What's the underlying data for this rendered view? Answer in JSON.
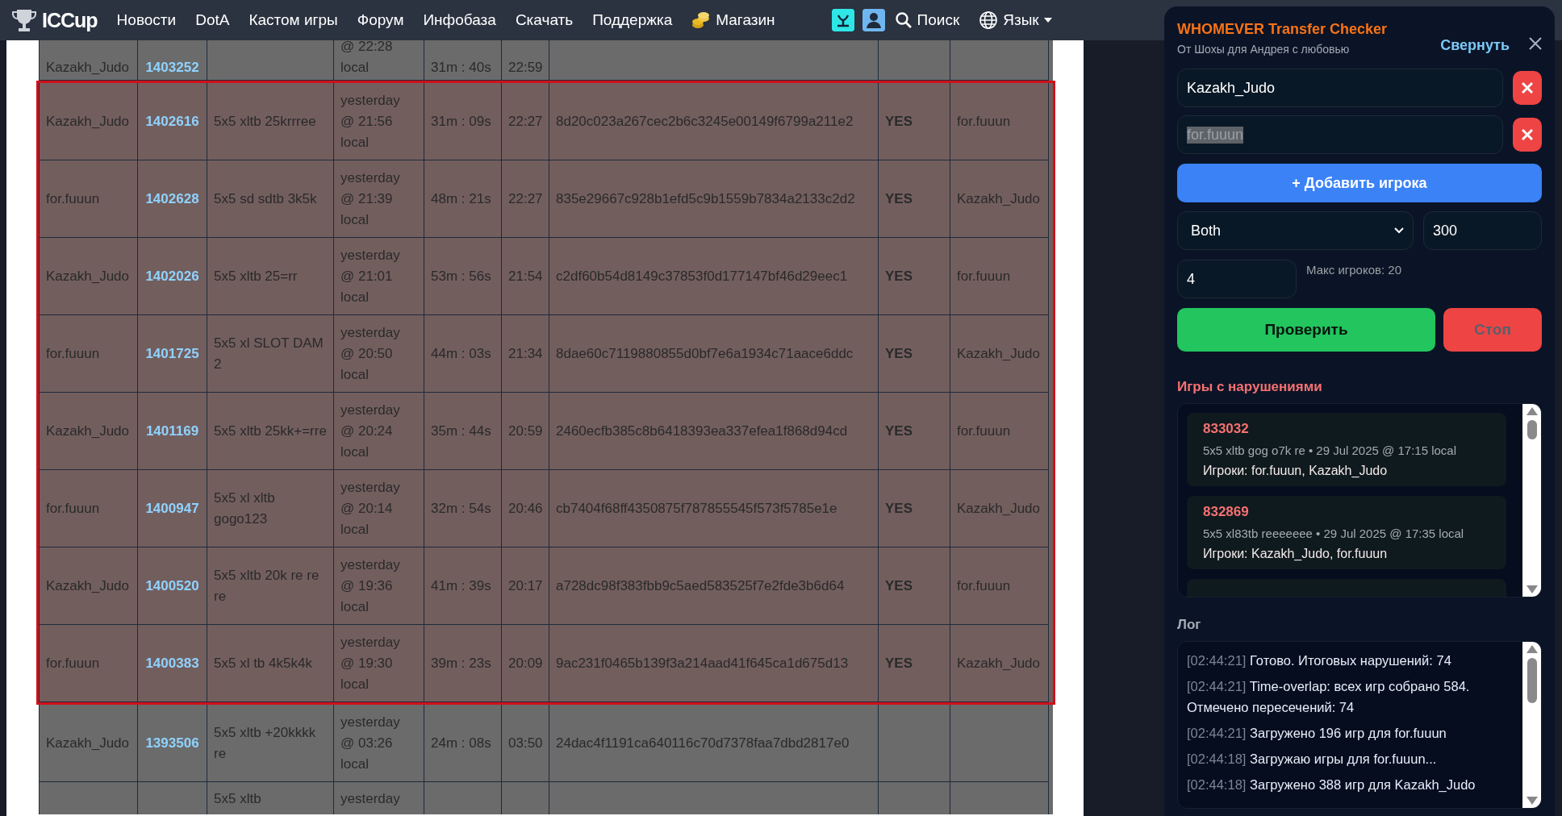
{
  "nav": {
    "logo": "ICCup",
    "items": [
      {
        "label": "Новости"
      },
      {
        "label": "DotA"
      },
      {
        "label": "Кастом игры"
      },
      {
        "label": "Форум"
      },
      {
        "label": "Инфобаза"
      },
      {
        "label": "Скачать"
      },
      {
        "label": "Поддержка"
      },
      {
        "label": "Магазин",
        "kind": "shop"
      }
    ],
    "search": "Поиск",
    "language": "Язык"
  },
  "table": {
    "rows": [
      {
        "player": "Kazakh_Judo",
        "game_id": "1403252",
        "game_name": "",
        "date": "@ 22:28 local",
        "duration": "31m : 40s",
        "end": "22:59",
        "hash": "",
        "transfer": "",
        "recipient": "",
        "flagged": false,
        "kind": "cut-top"
      },
      {
        "player": "Kazakh_Judo",
        "game_id": "1402616",
        "game_name": "5x5 xltb 25krrree",
        "date": "yesterday @ 21:56 local",
        "duration": "31m : 09s",
        "end": "22:27",
        "hash": "8d20c023a267cec2b6c3245e00149f6799a211e2",
        "transfer": "YES",
        "recipient": "for.fuuun",
        "flagged": true,
        "kind": "full"
      },
      {
        "player": "for.fuuun",
        "game_id": "1402628",
        "game_name": "5x5 sd sdtb 3k5k",
        "date": "yesterday @ 21:39 local",
        "duration": "48m : 21s",
        "end": "22:27",
        "hash": "835e29667c928b1efd5c9b1559b7834a2133c2d2",
        "transfer": "YES",
        "recipient": "Kazakh_Judo",
        "flagged": true,
        "kind": "full"
      },
      {
        "player": "Kazakh_Judo",
        "game_id": "1402026",
        "game_name": "5x5 xltb 25=rr",
        "date": "yesterday @ 21:01 local",
        "duration": "53m : 56s",
        "end": "21:54",
        "hash": "c2df60b54d8149c37853f0d177147bf46d29eec1",
        "transfer": "YES",
        "recipient": "for.fuuun",
        "flagged": true,
        "kind": "full"
      },
      {
        "player": "for.fuuun",
        "game_id": "1401725",
        "game_name": "5x5 xl SLOT DAM 2",
        "date": "yesterday @ 20:50 local",
        "duration": "44m : 03s",
        "end": "21:34",
        "hash": "8dae60c7119880855d0bf7e6a1934c71aace6ddc",
        "transfer": "YES",
        "recipient": "Kazakh_Judo",
        "flagged": true,
        "kind": "full"
      },
      {
        "player": "Kazakh_Judo",
        "game_id": "1401169",
        "game_name": "5x5 xltb 25kk+=rre",
        "date": "yesterday @ 20:24 local",
        "duration": "35m : 44s",
        "end": "20:59",
        "hash": "2460ecfb385c8b6418393ea337efea1f868d94cd",
        "transfer": "YES",
        "recipient": "for.fuuun",
        "flagged": true,
        "kind": "full"
      },
      {
        "player": "for.fuuun",
        "game_id": "1400947",
        "game_name": "5x5 xl xltb gogo123",
        "date": "yesterday @ 20:14 local",
        "duration": "32m : 54s",
        "end": "20:46",
        "hash": "cb7404f68ff4350875f787855545f573f5785e1e",
        "transfer": "YES",
        "recipient": "Kazakh_Judo",
        "flagged": true,
        "kind": "full"
      },
      {
        "player": "Kazakh_Judo",
        "game_id": "1400520",
        "game_name": "5x5 xltb 20k re re re",
        "date": "yesterday @ 19:36 local",
        "duration": "41m : 39s",
        "end": "20:17",
        "hash": "a728dc98f383fbb9c5aed583525f7e2fde3b6d64",
        "transfer": "YES",
        "recipient": "for.fuuun",
        "flagged": true,
        "kind": "full"
      },
      {
        "player": "for.fuuun",
        "game_id": "1400383",
        "game_name": "5x5 xl tb 4k5k4k",
        "date": "yesterday @ 19:30 local",
        "duration": "39m : 23s",
        "end": "20:09",
        "hash": "9ac231f0465b139f3a214aad41f645ca1d675d13",
        "transfer": "YES",
        "recipient": "Kazakh_Judo",
        "flagged": true,
        "kind": "full"
      },
      {
        "player": "Kazakh_Judo",
        "game_id": "1393506",
        "game_name": "5x5 xltb +20kkkk re",
        "date": "yesterday @ 03:26 local",
        "duration": "24m : 08s",
        "end": "03:50",
        "hash": "24dac4f1191ca640116c70d7378faa7dbd2817e0",
        "transfer": "",
        "recipient": "",
        "flagged": false,
        "kind": "full"
      },
      {
        "player": "",
        "game_id": "",
        "game_name": "5x5 xltb",
        "date": "yesterday",
        "duration": "",
        "end": "",
        "hash": "",
        "transfer": "",
        "recipient": "",
        "flagged": false,
        "kind": "cut-bottom"
      }
    ]
  },
  "panel": {
    "title": "WHOMEVER Transfer Checker",
    "subtitle": "От Шохы для Андрея с любовью",
    "collapse": "Свернуть",
    "players": [
      {
        "value": "Kazakh_Judo",
        "highlighted": false
      },
      {
        "value": "for.fuuun",
        "highlighted": true
      }
    ],
    "add_button": "+ Добавить игрока",
    "mode": "Both",
    "interval": "300",
    "threads": "4",
    "hint": "Макс игроков: 20",
    "check_button": "Проверить",
    "stop_button": {
      "label": "Стоп",
      "disabled": true
    },
    "violations_title": "Игры с нарушениями",
    "violations": [
      {
        "id": "833032",
        "info": "5x5 xltb gog o7k re • 29 Jul 2025 @ 17:15 local",
        "players": "Игроки: for.fuuun, Kazakh_Judo"
      },
      {
        "id": "832869",
        "info": "5x5 xl83tb reeeeeee • 29 Jul 2025 @ 17:35 local",
        "players": "Игроки: Kazakh_Judo, for.fuuun"
      }
    ],
    "log_title": "Лог",
    "log": [
      {
        "time": "[02:44:21]",
        "message": "Готово. Итоговых нарушений: 74"
      },
      {
        "time": "[02:44:21]",
        "message": "Time-overlap: всех игр собрано 584. Отмечено пересечений: 74"
      },
      {
        "time": "[02:44:21]",
        "message": "Загружено 196 игр для for.fuuun"
      },
      {
        "time": "[02:44:18]",
        "message": "Загружаю игры для for.fuuun..."
      },
      {
        "time": "[02:44:18]",
        "message": "Загружено 388 игр для Kazakh_Judo"
      }
    ]
  }
}
